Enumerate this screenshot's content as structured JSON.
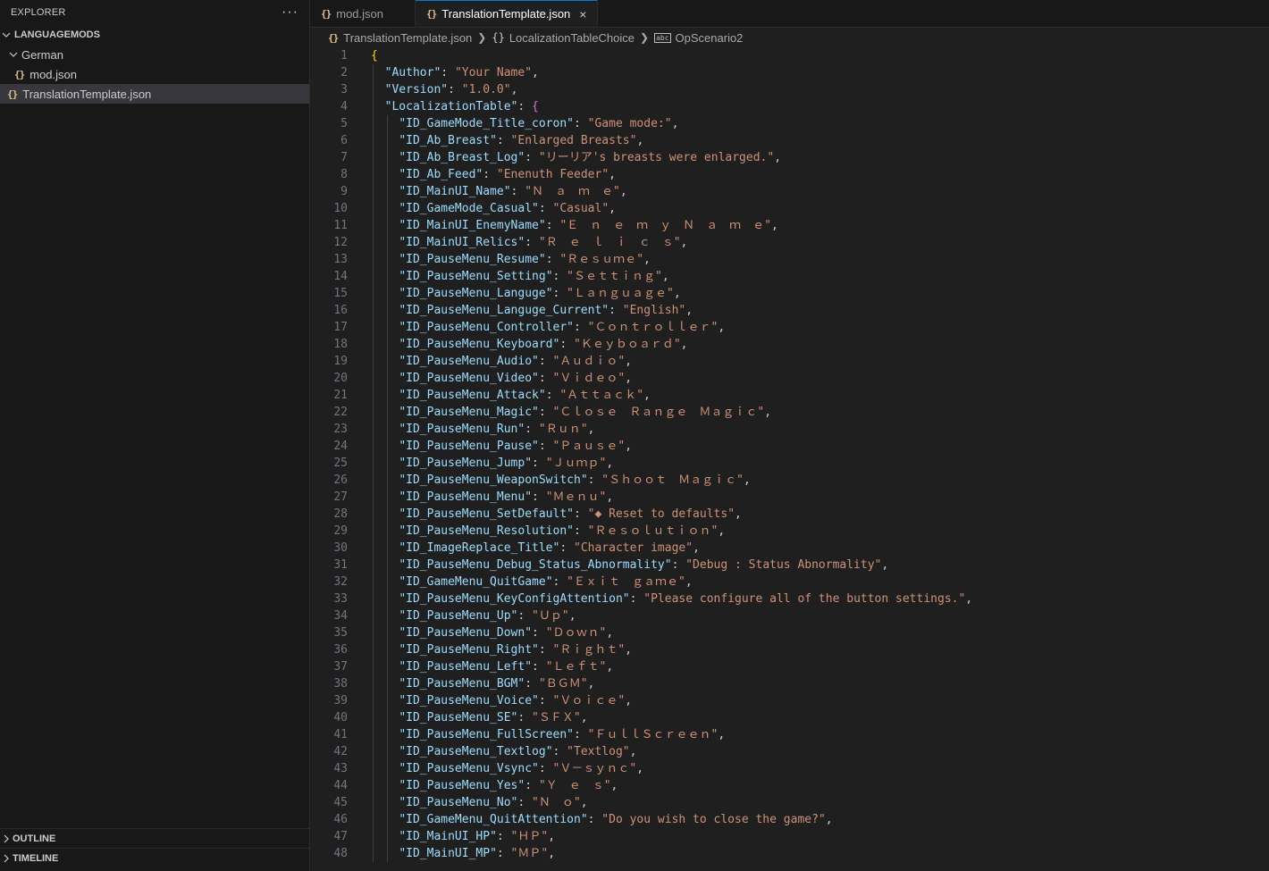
{
  "sidebar": {
    "title": "EXPLORER",
    "more": "···",
    "tree": [
      {
        "label": "LANGUAGEMODS",
        "depth": 0,
        "kind": "root",
        "expanded": true
      },
      {
        "label": "German",
        "depth": 1,
        "kind": "folder",
        "expanded": true
      },
      {
        "label": "mod.json",
        "depth": 2,
        "kind": "json"
      },
      {
        "label": "TranslationTemplate.json",
        "depth": 1,
        "kind": "json",
        "selected": true
      }
    ],
    "panels": [
      {
        "label": "OUTLINE"
      },
      {
        "label": "TIMELINE"
      }
    ]
  },
  "tabs": [
    {
      "label": "mod.json",
      "active": false
    },
    {
      "label": "TranslationTemplate.json",
      "active": true,
      "close": "×"
    }
  ],
  "breadcrumb": [
    "TranslationTemplate.json",
    "LocalizationTableChoice",
    "OpScenario2"
  ],
  "editor": {
    "lines": [
      {
        "n": "1",
        "i": 0,
        "open": "{"
      },
      {
        "n": "2",
        "i": 1,
        "key": "Author",
        "val": "Your Name"
      },
      {
        "n": "3",
        "i": 1,
        "key": "Version",
        "val": "1.0.0"
      },
      {
        "n": "4",
        "i": 1,
        "key": "LocalizationTable",
        "open": "{"
      },
      {
        "n": "5",
        "i": 2,
        "key": "ID_GameMode_Title_coron",
        "val": "Game mode:"
      },
      {
        "n": "6",
        "i": 2,
        "key": "ID_Ab_Breast",
        "val": "Enlarged Breasts"
      },
      {
        "n": "7",
        "i": 2,
        "key": "ID_Ab_Breast_Log",
        "val": "リーリア's breasts were enlarged."
      },
      {
        "n": "8",
        "i": 2,
        "key": "ID_Ab_Feed",
        "val": "Enenuth Feeder"
      },
      {
        "n": "9",
        "i": 2,
        "key": "ID_MainUI_Name",
        "val": "Ｎ　ａ　ｍ　ｅ"
      },
      {
        "n": "10",
        "i": 2,
        "key": "ID_GameMode_Casual",
        "val": "Casual"
      },
      {
        "n": "11",
        "i": 2,
        "key": "ID_MainUI_EnemyName",
        "val": "Ｅ　ｎ　ｅ　ｍ　ｙ　Ｎ　ａ　ｍ　ｅ"
      },
      {
        "n": "12",
        "i": 2,
        "key": "ID_MainUI_Relics",
        "val": "Ｒ　ｅ　ｌ　ｉ　ｃ　ｓ"
      },
      {
        "n": "13",
        "i": 2,
        "key": "ID_PauseMenu_Resume",
        "val": "Ｒｅｓｕｍｅ"
      },
      {
        "n": "14",
        "i": 2,
        "key": "ID_PauseMenu_Setting",
        "val": "Ｓｅｔｔｉｎｇ"
      },
      {
        "n": "15",
        "i": 2,
        "key": "ID_PauseMenu_Languge",
        "val": "Ｌａｎｇｕａｇｅ"
      },
      {
        "n": "16",
        "i": 2,
        "key": "ID_PauseMenu_Languge_Current",
        "val": "English"
      },
      {
        "n": "17",
        "i": 2,
        "key": "ID_PauseMenu_Controller",
        "val": "Ｃｏｎｔｒｏｌｌｅｒ"
      },
      {
        "n": "18",
        "i": 2,
        "key": "ID_PauseMenu_Keyboard",
        "val": "Ｋｅｙｂｏａｒｄ"
      },
      {
        "n": "19",
        "i": 2,
        "key": "ID_PauseMenu_Audio",
        "val": "Ａｕｄｉｏ"
      },
      {
        "n": "20",
        "i": 2,
        "key": "ID_PauseMenu_Video",
        "val": "Ｖｉｄｅｏ"
      },
      {
        "n": "21",
        "i": 2,
        "key": "ID_PauseMenu_Attack",
        "val": "Ａｔｔａｃｋ"
      },
      {
        "n": "22",
        "i": 2,
        "key": "ID_PauseMenu_Magic",
        "val": "Ｃｌｏｓｅ　Ｒａｎｇｅ　Ｍａｇｉｃ"
      },
      {
        "n": "23",
        "i": 2,
        "key": "ID_PauseMenu_Run",
        "val": "Ｒｕｎ"
      },
      {
        "n": "24",
        "i": 2,
        "key": "ID_PauseMenu_Pause",
        "val": "Ｐａｕｓｅ"
      },
      {
        "n": "25",
        "i": 2,
        "key": "ID_PauseMenu_Jump",
        "val": "Ｊｕｍｐ"
      },
      {
        "n": "26",
        "i": 2,
        "key": "ID_PauseMenu_WeaponSwitch",
        "val": "Ｓｈｏｏｔ　Ｍａｇｉｃ"
      },
      {
        "n": "27",
        "i": 2,
        "key": "ID_PauseMenu_Menu",
        "val": "Ｍｅｎｕ"
      },
      {
        "n": "28",
        "i": 2,
        "key": "ID_PauseMenu_SetDefault",
        "val": "◆ Reset to defaults"
      },
      {
        "n": "29",
        "i": 2,
        "key": "ID_PauseMenu_Resolution",
        "val": "Ｒｅｓｏｌｕｔｉｏｎ"
      },
      {
        "n": "30",
        "i": 2,
        "key": "ID_ImageReplace_Title",
        "val": "Character image"
      },
      {
        "n": "31",
        "i": 2,
        "key": "ID_PauseMenu_Debug_Status_Abnormality",
        "val": "Debug : Status Abnormality"
      },
      {
        "n": "32",
        "i": 2,
        "key": "ID_GameMenu_QuitGame",
        "val": "Ｅｘｉｔ　ｇａｍｅ"
      },
      {
        "n": "33",
        "i": 2,
        "key": "ID_PauseMenu_KeyConfigAttention",
        "val": "Please configure all of the button settings."
      },
      {
        "n": "34",
        "i": 2,
        "key": "ID_PauseMenu_Up",
        "val": "Ｕｐ"
      },
      {
        "n": "35",
        "i": 2,
        "key": "ID_PauseMenu_Down",
        "val": "Ｄｏｗｎ"
      },
      {
        "n": "36",
        "i": 2,
        "key": "ID_PauseMenu_Right",
        "val": "Ｒｉｇｈｔ"
      },
      {
        "n": "37",
        "i": 2,
        "key": "ID_PauseMenu_Left",
        "val": "Ｌｅｆｔ"
      },
      {
        "n": "38",
        "i": 2,
        "key": "ID_PauseMenu_BGM",
        "val": "ＢＧＭ"
      },
      {
        "n": "39",
        "i": 2,
        "key": "ID_PauseMenu_Voice",
        "val": "Ｖｏｉｃｅ"
      },
      {
        "n": "40",
        "i": 2,
        "key": "ID_PauseMenu_SE",
        "val": "ＳＦＸ"
      },
      {
        "n": "41",
        "i": 2,
        "key": "ID_PauseMenu_FullScreen",
        "val": "ＦｕｌｌＳｃｒｅｅｎ"
      },
      {
        "n": "42",
        "i": 2,
        "key": "ID_PauseMenu_Textlog",
        "val": "Textlog"
      },
      {
        "n": "43",
        "i": 2,
        "key": "ID_PauseMenu_Vsync",
        "val": "Ｖ－ｓｙｎｃ"
      },
      {
        "n": "44",
        "i": 2,
        "key": "ID_PauseMenu_Yes",
        "val": "Ｙ　ｅ　ｓ"
      },
      {
        "n": "45",
        "i": 2,
        "key": "ID_PauseMenu_No",
        "val": "Ｎ　ｏ"
      },
      {
        "n": "46",
        "i": 2,
        "key": "ID_GameMenu_QuitAttention",
        "val": "Do you wish to close the game?"
      },
      {
        "n": "47",
        "i": 2,
        "key": "ID_MainUI_HP",
        "val": "ＨＰ"
      },
      {
        "n": "48",
        "i": 2,
        "key": "ID_MainUI_MP",
        "val": "ＭＰ"
      }
    ]
  }
}
